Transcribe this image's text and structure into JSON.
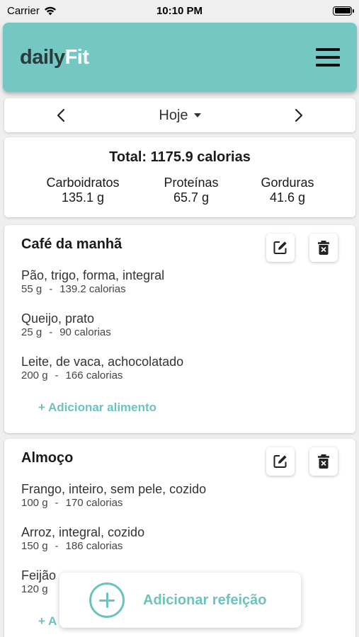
{
  "status_bar": {
    "carrier": "Carrier",
    "time": "10:10 PM"
  },
  "header": {
    "logo_part1": "daily",
    "logo_part2": "Fit"
  },
  "date_nav": {
    "label": "Hoje"
  },
  "totals": {
    "title": "Total: 1175.9 calorias",
    "carbs_label": "Carboidratos",
    "carbs_value": "135.1 g",
    "protein_label": "Proteínas",
    "protein_value": "65.7 g",
    "fat_label": "Gorduras",
    "fat_value": "41.6 g"
  },
  "meals": [
    {
      "title": "Café da manhã",
      "foods": [
        {
          "name": "Pão, trigo, forma, integral",
          "grams": "55 g",
          "calories": "139.2 calorias"
        },
        {
          "name": "Queijo, prato",
          "grams": "25 g",
          "calories": "90 calorias"
        },
        {
          "name": "Leite, de vaca, achocolatado",
          "grams": "200 g",
          "calories": "166 calorias"
        }
      ],
      "add_food": "+ Adicionar alimento"
    },
    {
      "title": "Almoço",
      "foods": [
        {
          "name": "Frango, inteiro, sem pele, cozido",
          "grams": "100 g",
          "calories": "170 calorias"
        },
        {
          "name": "Arroz, integral, cozido",
          "grams": "150 g",
          "calories": "186 calorias"
        },
        {
          "name": "Feijão",
          "grams": "120 g",
          "calories": ""
        }
      ],
      "add_food": "+ A"
    }
  ],
  "separator": "-",
  "add_meal": {
    "label": "Adicionar refeição"
  },
  "icons": [
    "wifi-icon",
    "battery-icon",
    "menu-icon",
    "chevron-left-icon",
    "chevron-right-icon",
    "caret-down-icon",
    "edit-icon",
    "trash-icon",
    "plus-circle-icon"
  ],
  "colors": {
    "accent": "#74c7c2",
    "accent_text": "#6cc2bd",
    "background": "#efefef"
  }
}
